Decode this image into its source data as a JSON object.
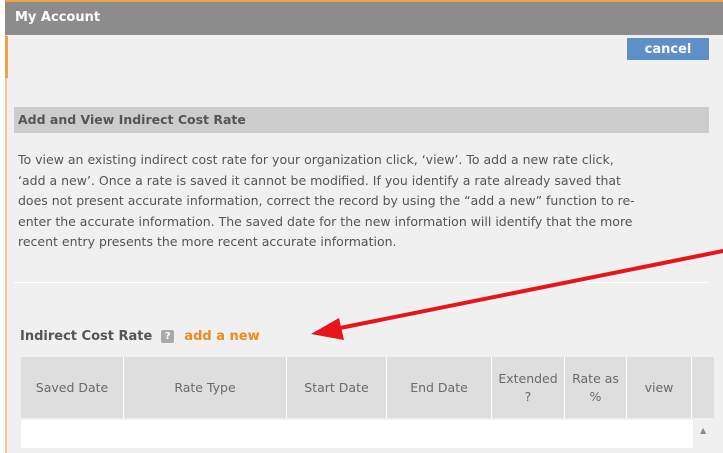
{
  "window": {
    "title": "My Account"
  },
  "toolbar": {
    "cancel_label": "cancel"
  },
  "section": {
    "title": "Add and View Indirect Cost Rate",
    "paragraph_lines": [
      "To view an existing indirect cost rate for your organization click, ‘view’. To add a new rate click,",
      "‘add a new’. Once a rate is saved it cannot be modified. If you identify a rate already saved that",
      "does not present accurate information, correct the record by using the “add a new” function to re-",
      "enter the accurate information. The saved date for the new information will identify that the more",
      "recent entry presents the more recent accurate information."
    ]
  },
  "indirect": {
    "title": "Indirect Cost Rate",
    "help_icon": "question-icon",
    "help_glyph": "?",
    "add_link": "add a new"
  },
  "table": {
    "headers": [
      {
        "lines": [
          "Saved Date"
        ]
      },
      {
        "lines": [
          "Rate Type"
        ]
      },
      {
        "lines": [
          "Start Date"
        ]
      },
      {
        "lines": [
          "End Date"
        ]
      },
      {
        "lines": [
          "Extended",
          "?"
        ]
      },
      {
        "lines": [
          "Rate as",
          "%"
        ]
      },
      {
        "lines": [
          "view"
        ]
      }
    ],
    "rows": []
  },
  "scrollbar": {
    "up_glyph": "▲"
  },
  "colors": {
    "titlebar": "#8c8c8c",
    "accent_orange": "#f08a1f",
    "cancel_button": "#5e8fc9",
    "annotation_arrow": "#e8141c"
  }
}
